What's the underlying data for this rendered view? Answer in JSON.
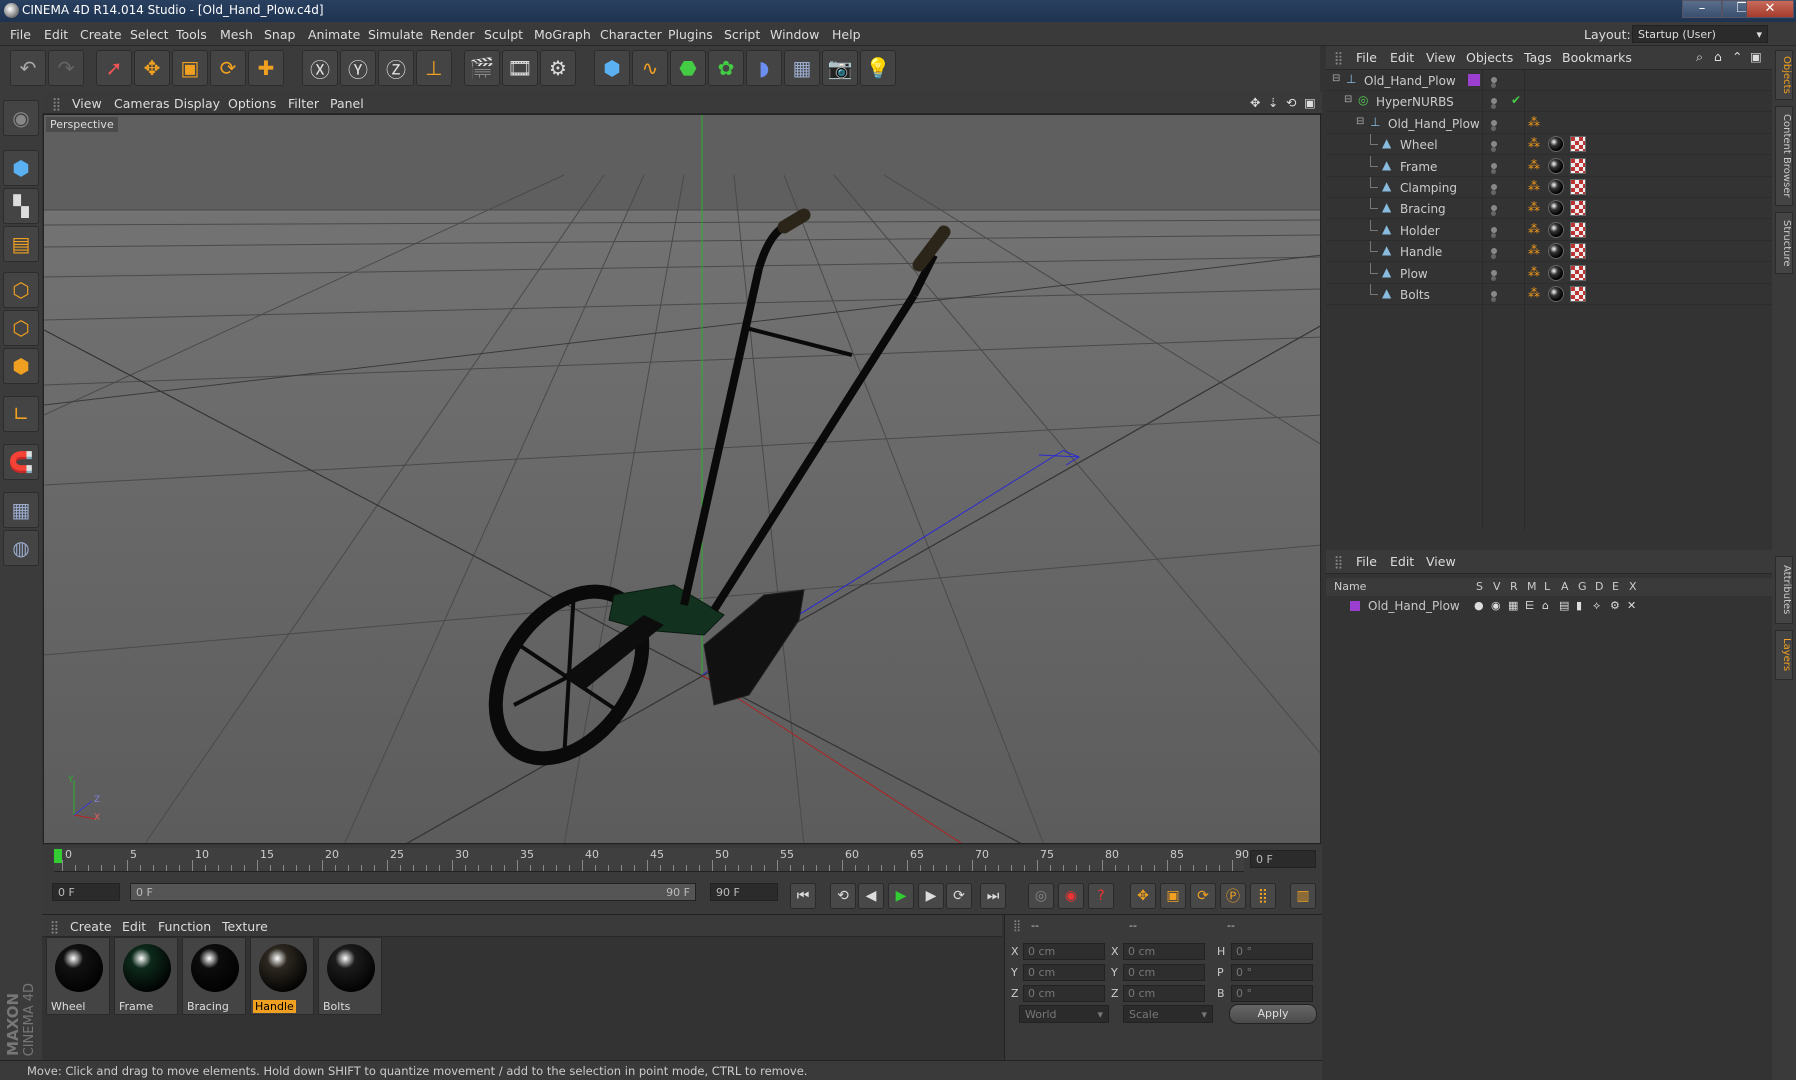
{
  "window": {
    "title": "CINEMA 4D R14.014 Studio - [Old_Hand_Plow.c4d]",
    "controls": [
      "–",
      "❐",
      "✕"
    ]
  },
  "menubar": {
    "items": [
      "File",
      "Edit",
      "Create",
      "Select",
      "Tools",
      "Mesh",
      "Snap",
      "Animate",
      "Simulate",
      "Render",
      "Sculpt",
      "MoGraph",
      "Character",
      "Plugins",
      "Script",
      "Window",
      "Help"
    ],
    "layout_label": "Layout:",
    "layout_value": "Startup (User)"
  },
  "viewport": {
    "menu": [
      "View",
      "Cameras",
      "Display",
      "Options",
      "Filter",
      "Panel"
    ],
    "camera_label": "Perspective",
    "axis_labels": [
      "Y",
      "Z",
      "X"
    ]
  },
  "timeline": {
    "ticks": [
      "0",
      "5",
      "10",
      "15",
      "20",
      "25",
      "30",
      "35",
      "40",
      "45",
      "50",
      "55",
      "60",
      "65",
      "70",
      "75",
      "80",
      "85",
      "90"
    ],
    "current_frame": "0 F",
    "start_field": "0 F",
    "range_start": "0 F",
    "range_end": "90 F",
    "end_field": "90 F"
  },
  "materials": {
    "menu": [
      "Create",
      "Edit",
      "Function",
      "Texture"
    ],
    "items": [
      {
        "name": "Wheel",
        "color": "#111111"
      },
      {
        "name": "Frame",
        "color": "#0d2a1c"
      },
      {
        "name": "Bracing",
        "color": "#0c0c0c"
      },
      {
        "name": "Handle",
        "color": "#2d2820",
        "selected": true
      },
      {
        "name": "Bolts",
        "color": "#1c1c1c"
      }
    ],
    "brand_top": "MAXON",
    "brand_bottom": "CINEMA 4D"
  },
  "coords": {
    "headers": [
      "--",
      "--",
      "--"
    ],
    "rows": [
      {
        "a": "X",
        "av": "0 cm",
        "b": "X",
        "bv": "0 cm",
        "c": "H",
        "cv": "0 °"
      },
      {
        "a": "Y",
        "av": "0 cm",
        "b": "Y",
        "bv": "0 cm",
        "c": "P",
        "cv": "0 °"
      },
      {
        "a": "Z",
        "av": "0 cm",
        "b": "Z",
        "bv": "0 cm",
        "c": "B",
        "cv": "0 °"
      }
    ],
    "space": "World",
    "mode": "Scale",
    "apply": "Apply"
  },
  "status": "Move: Click and drag to move elements. Hold down SHIFT to quantize movement / add to the selection in point mode, CTRL to remove.",
  "objects": {
    "menu": [
      "File",
      "Edit",
      "View",
      "Objects",
      "Tags",
      "Bookmarks"
    ],
    "tree": [
      {
        "name": "Old_Hand_Plow",
        "level": 0,
        "type": "null"
      },
      {
        "name": "HyperNURBS",
        "level": 1,
        "type": "nurbs"
      },
      {
        "name": "Old_Hand_Plow",
        "level": 2,
        "type": "null"
      },
      {
        "name": "Wheel",
        "level": 3,
        "type": "poly"
      },
      {
        "name": "Frame",
        "level": 3,
        "type": "poly"
      },
      {
        "name": "Clamping",
        "level": 3,
        "type": "poly"
      },
      {
        "name": "Bracing",
        "level": 3,
        "type": "poly"
      },
      {
        "name": "Holder",
        "level": 3,
        "type": "poly"
      },
      {
        "name": "Handle",
        "level": 3,
        "type": "poly"
      },
      {
        "name": "Plow",
        "level": 3,
        "type": "poly"
      },
      {
        "name": "Bolts",
        "level": 3,
        "type": "poly"
      }
    ]
  },
  "layers": {
    "menu": [
      "File",
      "Edit",
      "View"
    ],
    "header_name": "Name",
    "columns": [
      "S",
      "V",
      "R",
      "M",
      "L",
      "A",
      "G",
      "D",
      "E",
      "X"
    ],
    "rows": [
      {
        "name": "Old_Hand_Plow",
        "color": "#9b3fd0"
      }
    ]
  },
  "sidetabs": [
    "Objects",
    "Content Browser",
    "Structure",
    "Attributes",
    "Layers"
  ]
}
